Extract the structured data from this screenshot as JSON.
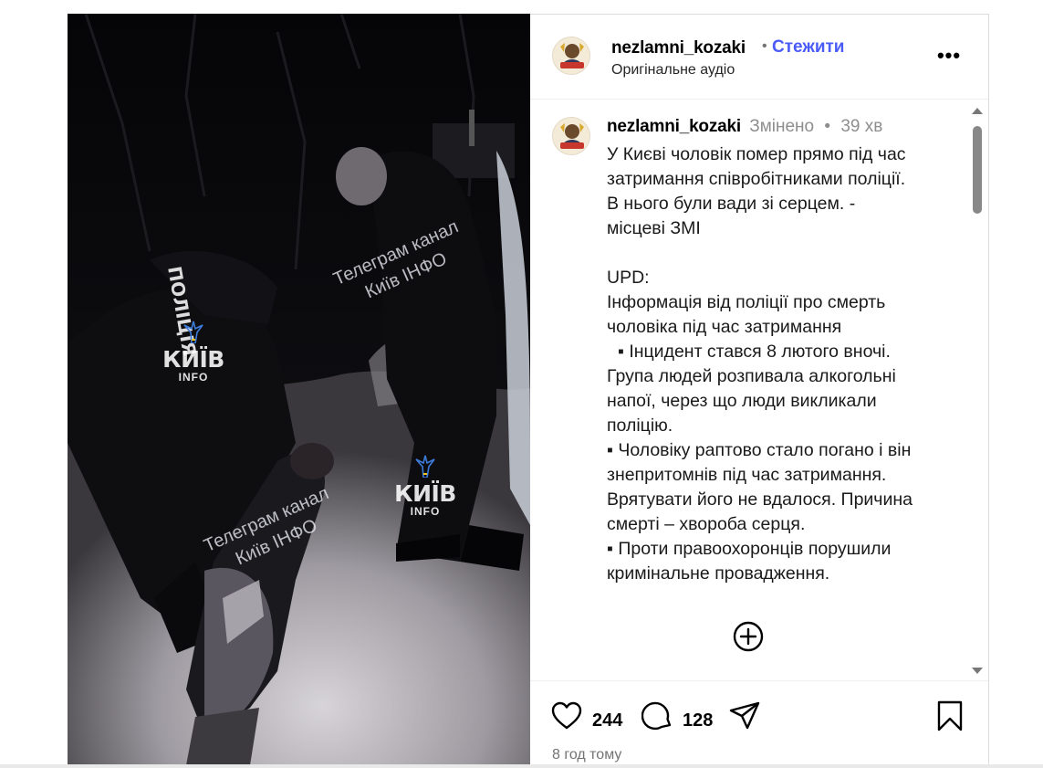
{
  "post": {
    "username": "nezlamni_kozaki",
    "separator": "•",
    "follow_label": "Стежити",
    "audio_label": "Оригінальне аудіо",
    "more_label": "•••"
  },
  "media": {
    "watermark_line1": "Телеграм канал",
    "watermark_line2": "Київ ІНФО",
    "logo_main": "КИЇВ",
    "logo_sub": "INFO",
    "vest_text": "ПОЛІЦІЯ"
  },
  "caption": {
    "username": "nezlamni_kozaki",
    "edited_label": "Змінено",
    "separator": "•",
    "time": "39 хв",
    "lines": [
      "У Києві чоловік помер прямо під час",
      "затримання співробітниками поліції.",
      "В нього були вади зі серцем. -",
      "місцеві ЗМІ",
      "",
      "UPD:",
      "Інформація від поліції про смерть",
      "чоловіка під час затримання",
      "▪ Інцидент стався 8 лютого вночі.",
      "Група людей розпивала алкогольні",
      "напої, через що люди викликали",
      "поліцію.",
      "▪ Чоловіку раптово стало погано і він",
      "знепритомнів під час затримання.",
      "Врятувати його не вдалося. Причина",
      "смерті – хвороба серця.",
      "▪ Проти правоохоронців порушили",
      "кримінальне провадження."
    ]
  },
  "actions": {
    "likes": "244",
    "comments": "128",
    "posted_ago": "8 год тому"
  },
  "icons": {
    "like": "heart-icon",
    "comment": "comment-bubble-icon",
    "share": "paper-plane-icon",
    "save": "bookmark-icon",
    "add": "plus-circle-icon",
    "more": "more-options-icon"
  },
  "colors": {
    "follow_link": "#4a5bf7",
    "muted_text": "#8e8e8e",
    "border": "#dbdbdb"
  }
}
